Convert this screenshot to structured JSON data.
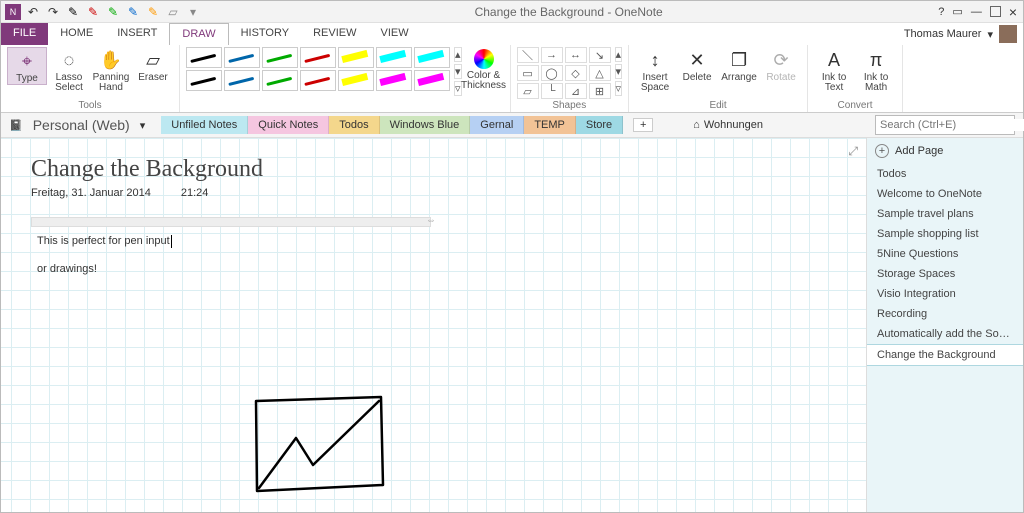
{
  "titlebar": {
    "title": "Change the Background - OneNote"
  },
  "menu": {
    "file": "FILE",
    "home": "HOME",
    "insert": "INSERT",
    "draw": "DRAW",
    "history": "HISTORY",
    "review": "REVIEW",
    "view": "VIEW",
    "user": "Thomas Maurer"
  },
  "ribbon": {
    "tools": {
      "label": "Tools",
      "type": "Type",
      "lasso": "Lasso Select",
      "panning": "Panning Hand",
      "eraser": "Eraser"
    },
    "colorthick": {
      "label": "Color & Thickness"
    },
    "shapes": {
      "label": "Shapes"
    },
    "edit": {
      "label": "Edit",
      "insertspace": "Insert Space",
      "delete": "Delete",
      "arrange": "Arrange",
      "rotate": "Rotate"
    },
    "convert": {
      "label": "Convert",
      "inktext": "Ink to Text",
      "inkmath": "Ink to Math"
    }
  },
  "notebook": {
    "name": "Personal (Web)",
    "wohnungen": "Wohnungen",
    "search_ph": "Search (Ctrl+E)"
  },
  "sections": [
    "Unfiled Notes",
    "Quick Notes",
    "Todos",
    "Windows Blue",
    "Gernal",
    "TEMP",
    "Store"
  ],
  "page": {
    "title": "Change the Background",
    "date": "Freitag, 31. Januar 2014",
    "time": "21:24",
    "line1": "This is perfect for pen input",
    "line2": "or drawings!"
  },
  "side": {
    "add": "Add Page",
    "items": [
      "Todos",
      "Welcome to OneNote",
      "Sample travel plans",
      "Sample shopping list",
      "5Nine Questions",
      "Storage Spaces",
      "Visio Integration",
      "Recording",
      "Automatically add the Source Lin",
      "Change the Background"
    ]
  }
}
